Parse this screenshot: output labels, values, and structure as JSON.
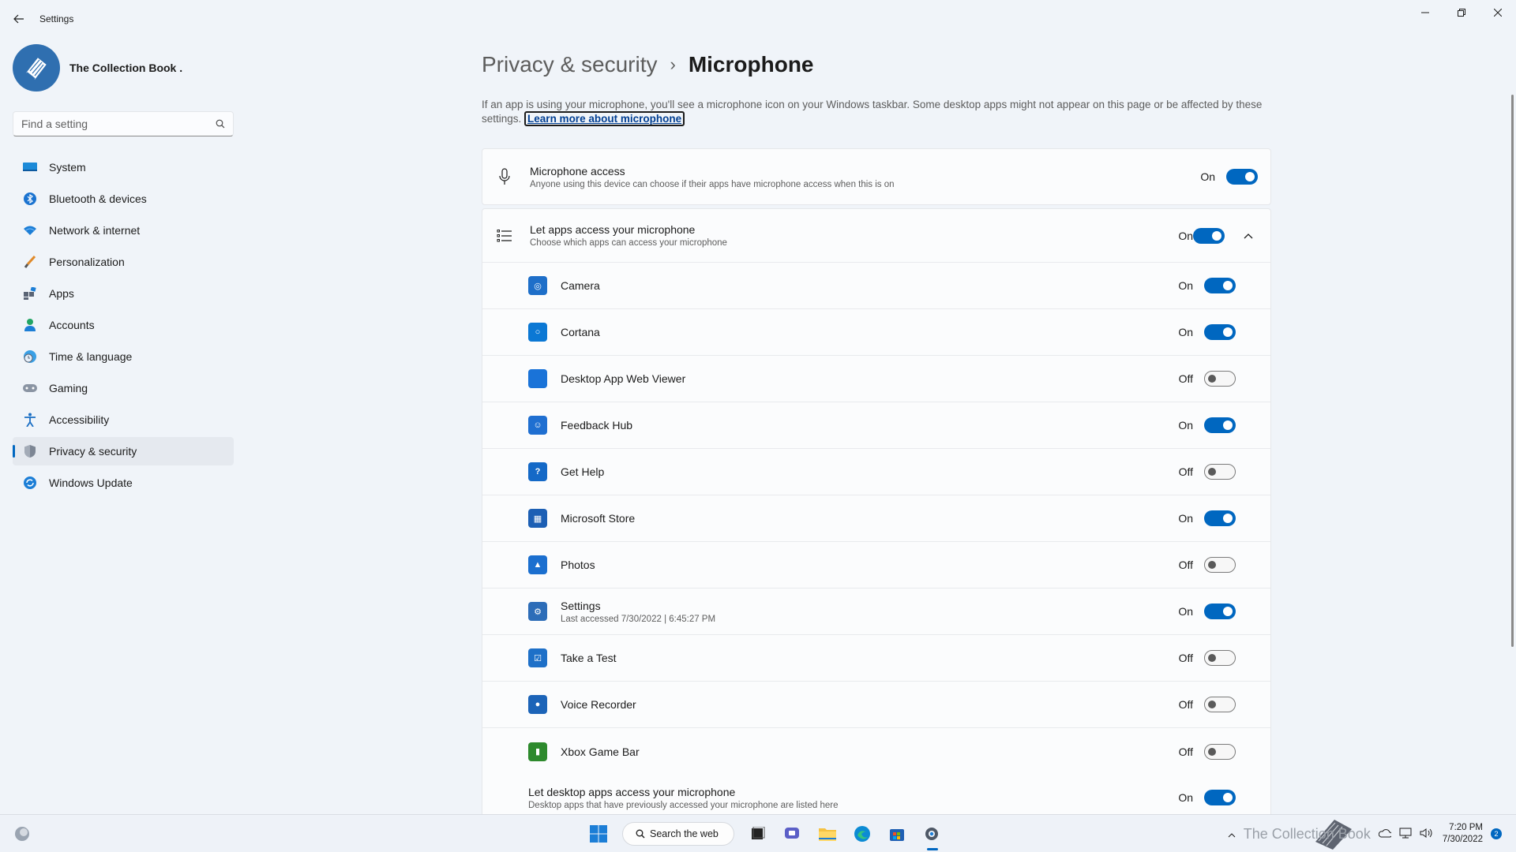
{
  "window": {
    "title": "Settings"
  },
  "profile": {
    "name": "The Collection Book ."
  },
  "search": {
    "placeholder": "Find a setting"
  },
  "sidebar": {
    "items": [
      {
        "label": "System",
        "icon": "system-icon"
      },
      {
        "label": "Bluetooth & devices",
        "icon": "bluetooth-icon"
      },
      {
        "label": "Network & internet",
        "icon": "wifi-icon"
      },
      {
        "label": "Personalization",
        "icon": "brush-icon"
      },
      {
        "label": "Apps",
        "icon": "apps-icon"
      },
      {
        "label": "Accounts",
        "icon": "person-icon"
      },
      {
        "label": "Time & language",
        "icon": "clock-globe-icon"
      },
      {
        "label": "Gaming",
        "icon": "gamepad-icon"
      },
      {
        "label": "Accessibility",
        "icon": "accessibility-icon"
      },
      {
        "label": "Privacy & security",
        "icon": "shield-icon",
        "active": true
      },
      {
        "label": "Windows Update",
        "icon": "update-icon"
      }
    ]
  },
  "main": {
    "breadcrumb_parent": "Privacy & security",
    "breadcrumb_sep": "›",
    "breadcrumb_current": "Microphone",
    "description": "If an app is using your microphone, you'll see a microphone icon on your Windows taskbar. Some desktop apps might not appear on this page or be affected by these settings.",
    "learn_more": "Learn more about microphone",
    "mic_access": {
      "title": "Microphone access",
      "subtitle": "Anyone using this device can choose if their apps have microphone access when this is on",
      "state": "On"
    },
    "let_apps": {
      "title": "Let apps access your microphone",
      "subtitle": "Choose which apps can access your microphone",
      "state": "On"
    },
    "apps": [
      {
        "name": "Camera",
        "state": "On",
        "color": "#1e6fc9",
        "glyph": "◎"
      },
      {
        "name": "Cortana",
        "state": "On",
        "color": "#0b78d4",
        "glyph": "○"
      },
      {
        "name": "Desktop App Web Viewer",
        "state": "Off",
        "color": "#1a73d8",
        "glyph": ""
      },
      {
        "name": "Feedback Hub",
        "state": "On",
        "color": "#1f6fd1",
        "glyph": "☺"
      },
      {
        "name": "Get Help",
        "state": "Off",
        "color": "#1469c7",
        "glyph": "?"
      },
      {
        "name": "Microsoft Store",
        "state": "On",
        "color": "#1c5fb4",
        "glyph": "▦"
      },
      {
        "name": "Photos",
        "state": "Off",
        "color": "#1b6fcf",
        "glyph": "▲"
      },
      {
        "name": "Settings",
        "sub": "Last accessed 7/30/2022  |  6:45:27 PM",
        "state": "On",
        "color": "#2d6db8",
        "glyph": "⚙"
      },
      {
        "name": "Take a Test",
        "state": "Off",
        "color": "#1e70c8",
        "glyph": "☑"
      },
      {
        "name": "Voice Recorder",
        "state": "Off",
        "color": "#1c64b8",
        "glyph": "●"
      },
      {
        "name": "Xbox Game Bar",
        "state": "Off",
        "color": "#2d8a2d",
        "glyph": "▮"
      }
    ],
    "desktop_apps": {
      "title": "Let desktop apps access your microphone",
      "subtitle": "Desktop apps that have previously accessed your microphone are listed here",
      "state": "On"
    }
  },
  "taskbar": {
    "search_label": "Search the web",
    "time": "7:20 PM",
    "date": "7/30/2022",
    "watermark": "The Collection Book",
    "notifications": "2"
  },
  "colors": {
    "accent": "#0067c0",
    "background": "#f0f4f9"
  }
}
